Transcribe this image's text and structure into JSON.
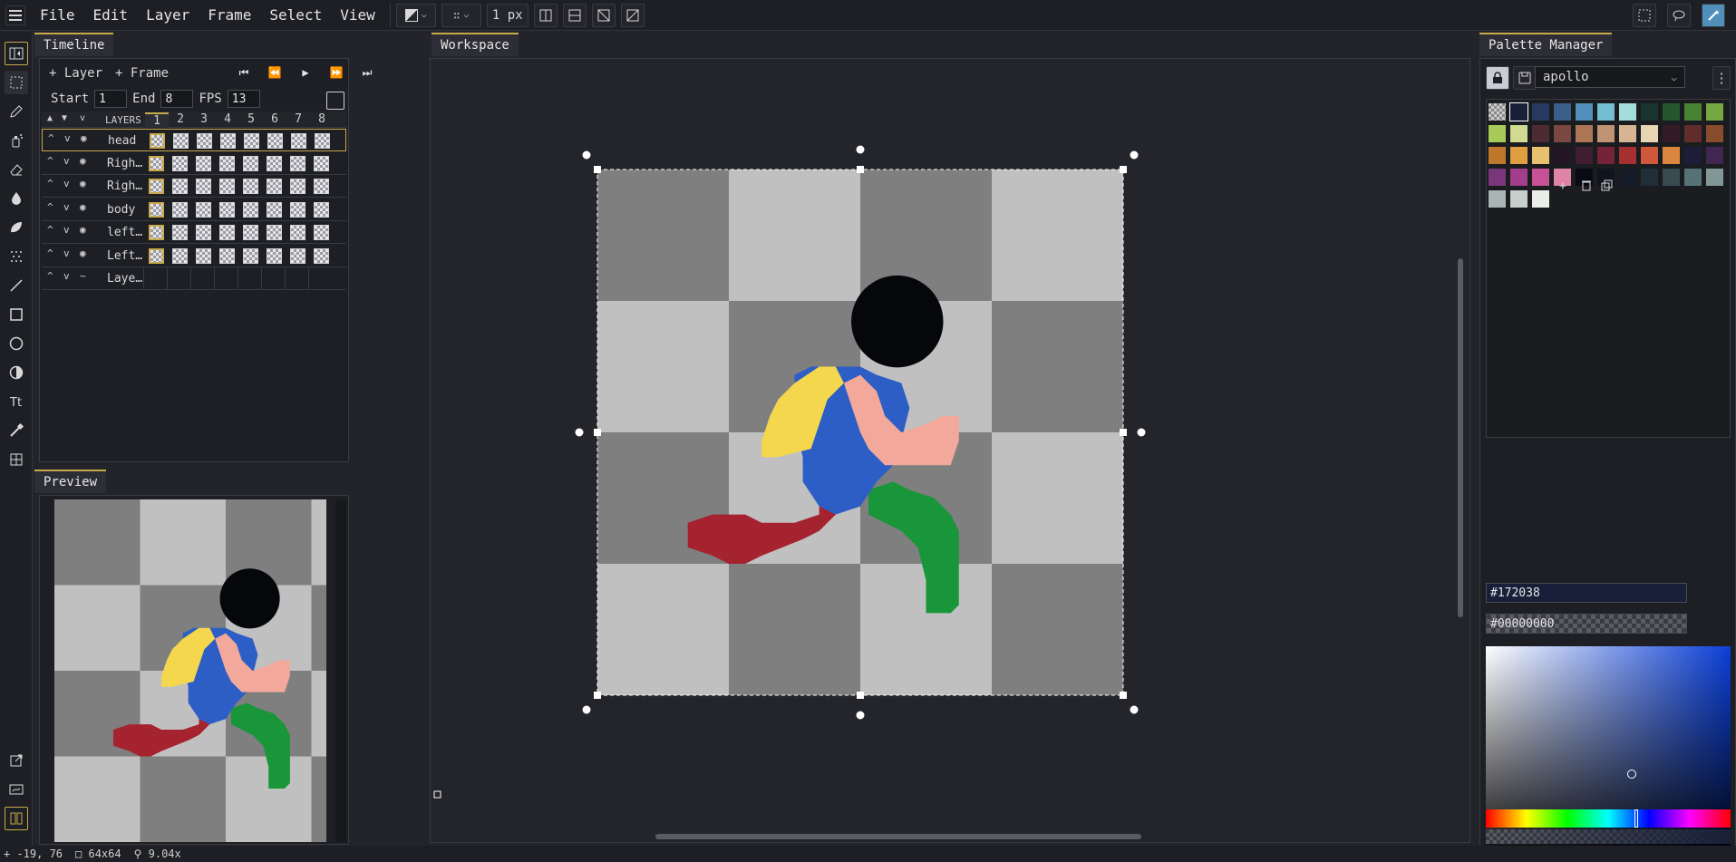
{
  "menu": {
    "items": [
      "File",
      "Edit",
      "Layer",
      "Frame",
      "Select",
      "View"
    ],
    "brush_size": "1 px"
  },
  "tools": [
    "move-icon",
    "rect-select-icon",
    "pencil-icon",
    "spray-icon",
    "eraser-icon",
    "bucket-icon",
    "shading-icon",
    "dither-icon",
    "line-icon",
    "rectangle-icon",
    "ellipse-icon",
    "contrast-icon",
    "text-icon",
    "eyedropper-icon",
    "grid-icon",
    "export-icon",
    "preview-icon",
    "frames-icon"
  ],
  "timeline": {
    "tab": "Timeline",
    "add_layer": "+ Layer",
    "add_frame": "+ Frame",
    "start_label": "Start",
    "start_value": "1",
    "end_label": "End",
    "end_value": "8",
    "fps_label": "FPS",
    "fps_value": "13",
    "layers_header": "LAYERS",
    "frames": [
      "1",
      "2",
      "3",
      "4",
      "5",
      "6",
      "7",
      "8"
    ],
    "layers": [
      {
        "name": "head",
        "selected": true
      },
      {
        "name": "Righ…"
      },
      {
        "name": "Righ…"
      },
      {
        "name": "body"
      },
      {
        "name": "left…"
      },
      {
        "name": "Left…"
      },
      {
        "name": "Laye…",
        "empty": true
      }
    ]
  },
  "preview": {
    "tab": "Preview"
  },
  "workspace": {
    "tab": "Workspace"
  },
  "palette": {
    "tab": "Palette Manager",
    "name": "apollo",
    "primary_hex": "#172038",
    "secondary_hex": "#00000000",
    "swatches": [
      "transparent",
      "#172038",
      "#253a5e",
      "#3c5e8b",
      "#4f8fba",
      "#73bed3",
      "#a4dddb",
      "#19332d",
      "#25562e",
      "#468232",
      "#75a743",
      "#a8ca58",
      "#d0da91",
      "#4d2b32",
      "#7a4841",
      "#ad7757",
      "#c09473",
      "#d7b594",
      "#e7d5b3",
      "#341c27",
      "#602c2c",
      "#884b2b",
      "#be772b",
      "#de9e41",
      "#e8c170",
      "#241527",
      "#411d31",
      "#752438",
      "#a53030",
      "#cf573c",
      "#da863e",
      "#1e1d39",
      "#402751",
      "#7a367b",
      "#a23e8c",
      "#c65197",
      "#df84a5",
      "#090a14",
      "#10141f",
      "#151d28",
      "#202e37",
      "#394a50",
      "#577277",
      "#819796",
      "#a8b5b2",
      "#c7cfcc",
      "#ebede9"
    ]
  }
}
